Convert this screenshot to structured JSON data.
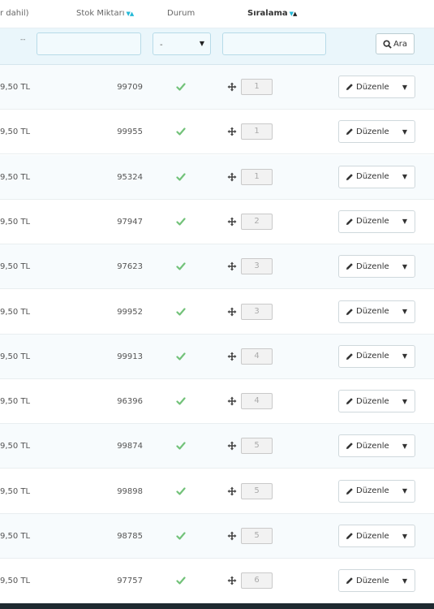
{
  "columns": {
    "price": "r dahil)",
    "stock": "Stok Miktarı",
    "status": "Durum",
    "order": "Sıralama"
  },
  "filters": {
    "dash": "--",
    "status_select": "-",
    "search_button": "Ara"
  },
  "rows": [
    {
      "price": "9,50 TL",
      "stock": "99709",
      "position": "1",
      "edit": "Düzenle"
    },
    {
      "price": "9,50 TL",
      "stock": "99955",
      "position": "1",
      "edit": "Düzenle"
    },
    {
      "price": "9,50 TL",
      "stock": "95324",
      "position": "1",
      "edit": "Düzenle"
    },
    {
      "price": "9,50 TL",
      "stock": "97947",
      "position": "2",
      "edit": "Düzenle"
    },
    {
      "price": "9,50 TL",
      "stock": "97623",
      "position": "3",
      "edit": "Düzenle"
    },
    {
      "price": "9,50 TL",
      "stock": "99952",
      "position": "3",
      "edit": "Düzenle"
    },
    {
      "price": "9,50 TL",
      "stock": "99913",
      "position": "4",
      "edit": "Düzenle"
    },
    {
      "price": "9,50 TL",
      "stock": "96396",
      "position": "4",
      "edit": "Düzenle"
    },
    {
      "price": "9,50 TL",
      "stock": "99874",
      "position": "5",
      "edit": "Düzenle"
    },
    {
      "price": "9,50 TL",
      "stock": "99898",
      "position": "5",
      "edit": "Düzenle"
    },
    {
      "price": "9,50 TL",
      "stock": "98785",
      "position": "5",
      "edit": "Düzenle"
    },
    {
      "price": "9,50 TL",
      "stock": "97757",
      "position": "6",
      "edit": "Düzenle"
    }
  ],
  "colors": {
    "accent": "#25b9d7",
    "check": "#72c279",
    "filter_bg": "#eaf6fb"
  }
}
